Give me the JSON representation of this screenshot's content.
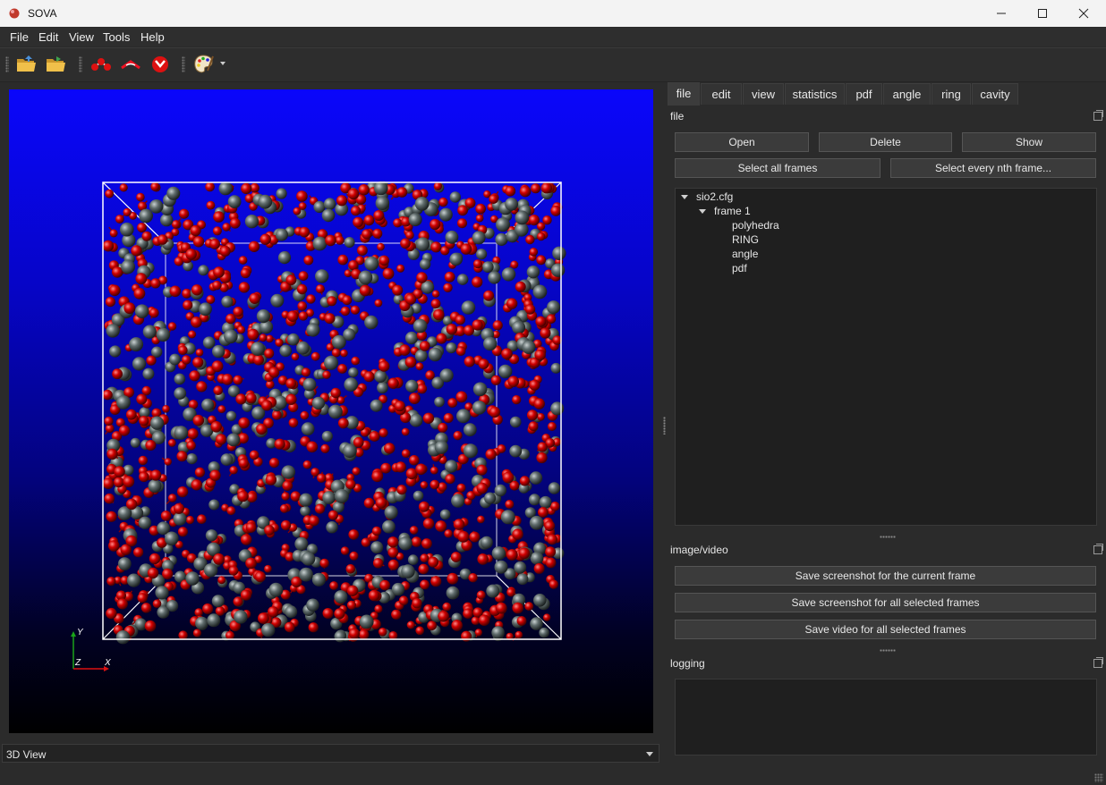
{
  "window": {
    "title": "SOVA",
    "minimize_icon": "minimize-icon",
    "maximize_icon": "maximize-icon",
    "close_icon": "close-icon"
  },
  "menu": [
    "File",
    "Edit",
    "View",
    "Tools",
    "Help"
  ],
  "toolbar": {
    "icons": [
      "open-folder-icon",
      "open-file-icon",
      "atoms-bonds-icon",
      "angle-icon",
      "atom-sphere-icon",
      "palette-icon"
    ]
  },
  "viewport": {
    "axis_labels": {
      "y": "Y",
      "z": "Z",
      "x": "X"
    },
    "colors": {
      "oxygen": "#d00000",
      "silicon": "#5f6b6b",
      "box": "#ffffff"
    }
  },
  "view_mode": {
    "selected": "3D View"
  },
  "tabs": [
    "file",
    "edit",
    "view",
    "statistics",
    "pdf",
    "angle",
    "ring",
    "cavity"
  ],
  "active_tab": "file",
  "file_panel": {
    "title": "file",
    "buttons": {
      "open": "Open",
      "delete": "Delete",
      "show": "Show",
      "select_all": "Select all frames",
      "select_nth": "Select every nth frame..."
    },
    "tree": {
      "root": "sio2.cfg",
      "frame": "frame 1",
      "children": [
        "polyhedra",
        "RING",
        "angle",
        "pdf"
      ]
    }
  },
  "image_video": {
    "title": "image/video",
    "buttons": [
      "Save screenshot for the current frame",
      "Save screenshot for all selected frames",
      "Save video for all selected frames"
    ]
  },
  "logging": {
    "title": "logging"
  }
}
